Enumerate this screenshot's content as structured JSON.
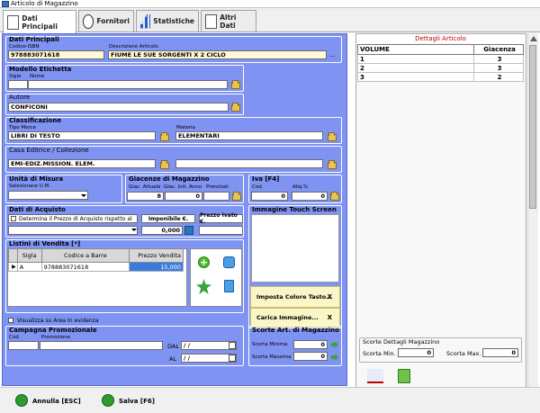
{
  "window": {
    "title": "Articolo di Magazzino"
  },
  "tabs": [
    {
      "label": "Dati Principali",
      "icon": "document-icon"
    },
    {
      "label": "Fornitori",
      "icon": "user-search-icon"
    },
    {
      "label": "Statistiche",
      "icon": "bar-chart-icon"
    },
    {
      "label": "Altri Dati",
      "icon": "document-edit-icon"
    }
  ],
  "dati_principali": {
    "title": "Dati Principali",
    "codice_label": "Codice-ISBN",
    "codice_value": "978883071618",
    "descrizione_label": "Descrizione Articolo",
    "descrizione_value": "FIUME LE SUE SORGENTI X 2 CICLO",
    "ellipsis": "..."
  },
  "modello_etichetta": {
    "title": "Modello Etichetta",
    "sigla_label": "Sigla",
    "nome_label": "Nome",
    "sigla_value": "",
    "nome_value": ""
  },
  "autore": {
    "title": "Autore",
    "value": "CONFICONI"
  },
  "classificazione": {
    "title": "Classificazione",
    "tipo_merce_label": "Tipo Merce",
    "tipo_merce_value": "LIBRI DI TESTO",
    "materia_label": "Materia",
    "materia_value": "ELEMENTARI"
  },
  "casa_editrice": {
    "title": "Casa Editrice / Collezione",
    "value": "EMI-EDIZ.MISSION. ELEM.",
    "collezione_value": ""
  },
  "unita_misura": {
    "title": "Unità di Misura",
    "label": "Selezionare U.M.",
    "value": ""
  },
  "giacenze": {
    "title": "Giacenze di Magazzino",
    "attuale_label": "Giac. Attuale",
    "attuale_value": "8",
    "iniz_label": "Giac. Init. Anno",
    "iniz_value": "0",
    "prenotati_label": "Prenotati",
    "prenotati_value": ""
  },
  "iva": {
    "title": "Iva [F4]",
    "cod_label": "Cod.",
    "cod_value": "0",
    "aliq_label": "Aliq.%",
    "aliq_value": "0"
  },
  "dati_acquisto": {
    "title": "Dati di Acquisto",
    "determina_label": "Determina il Prezzo di Acquisto rispetto al",
    "imponibile_label": "Imponibile €.",
    "prezzo_ivato_label": "Prezzo Ivato €.",
    "imponibile_value": "0,000",
    "prezzo_ivato_value": ""
  },
  "immagine": {
    "title": "Immagine Touch Screen",
    "imposta_colore": "Imposta Colore Tasto...",
    "carica_immagine": "Carica Immagine...",
    "x1": "X",
    "x2": "X"
  },
  "listini": {
    "title": "Listini di Vendita [*]",
    "columns": [
      "Sigla",
      "Codice a Barre",
      "Prezzo Vendita"
    ],
    "rows": [
      {
        "sigla": "A",
        "codice": "978883071618",
        "prezzo": "15,000"
      }
    ]
  },
  "visualizza": {
    "label": "Visualizza su Area In evidenza"
  },
  "campagna": {
    "title": "Campagna Promozionale",
    "cod_label": "Cod.",
    "promozione_label": "Promozione",
    "dal_label": "DAL",
    "al_label": "AL",
    "dal_value": "/ /",
    "al_value": "/ /"
  },
  "scorte": {
    "title": "Scorte Art. di Magazzino",
    "minima_label": "Scorta Minima",
    "minima_value": "0",
    "massima_label": "Scorta Massima",
    "massima_value": "0"
  },
  "dettagli": {
    "title": "Dettagli Articolo",
    "columns": [
      "VOLUME",
      "Giacenza"
    ],
    "rows": [
      {
        "volume": "1",
        "giacenza": "3"
      },
      {
        "volume": "2",
        "giacenza": "3"
      },
      {
        "volume": "3",
        "giacenza": "2"
      }
    ]
  },
  "scorte_dettagli": {
    "title": "Scorte Dettagli Magazzino",
    "min_label": "Scorta Min.",
    "min_value": "0",
    "max_label": "Scorta Max.",
    "max_value": "0"
  },
  "footer": {
    "annulla": "Annulla [ESC]",
    "salva": "Salva [F6]"
  },
  "colors": {
    "panel": "#7f93f2",
    "accent_red": "#c00000",
    "green": "#2f9a2f"
  }
}
